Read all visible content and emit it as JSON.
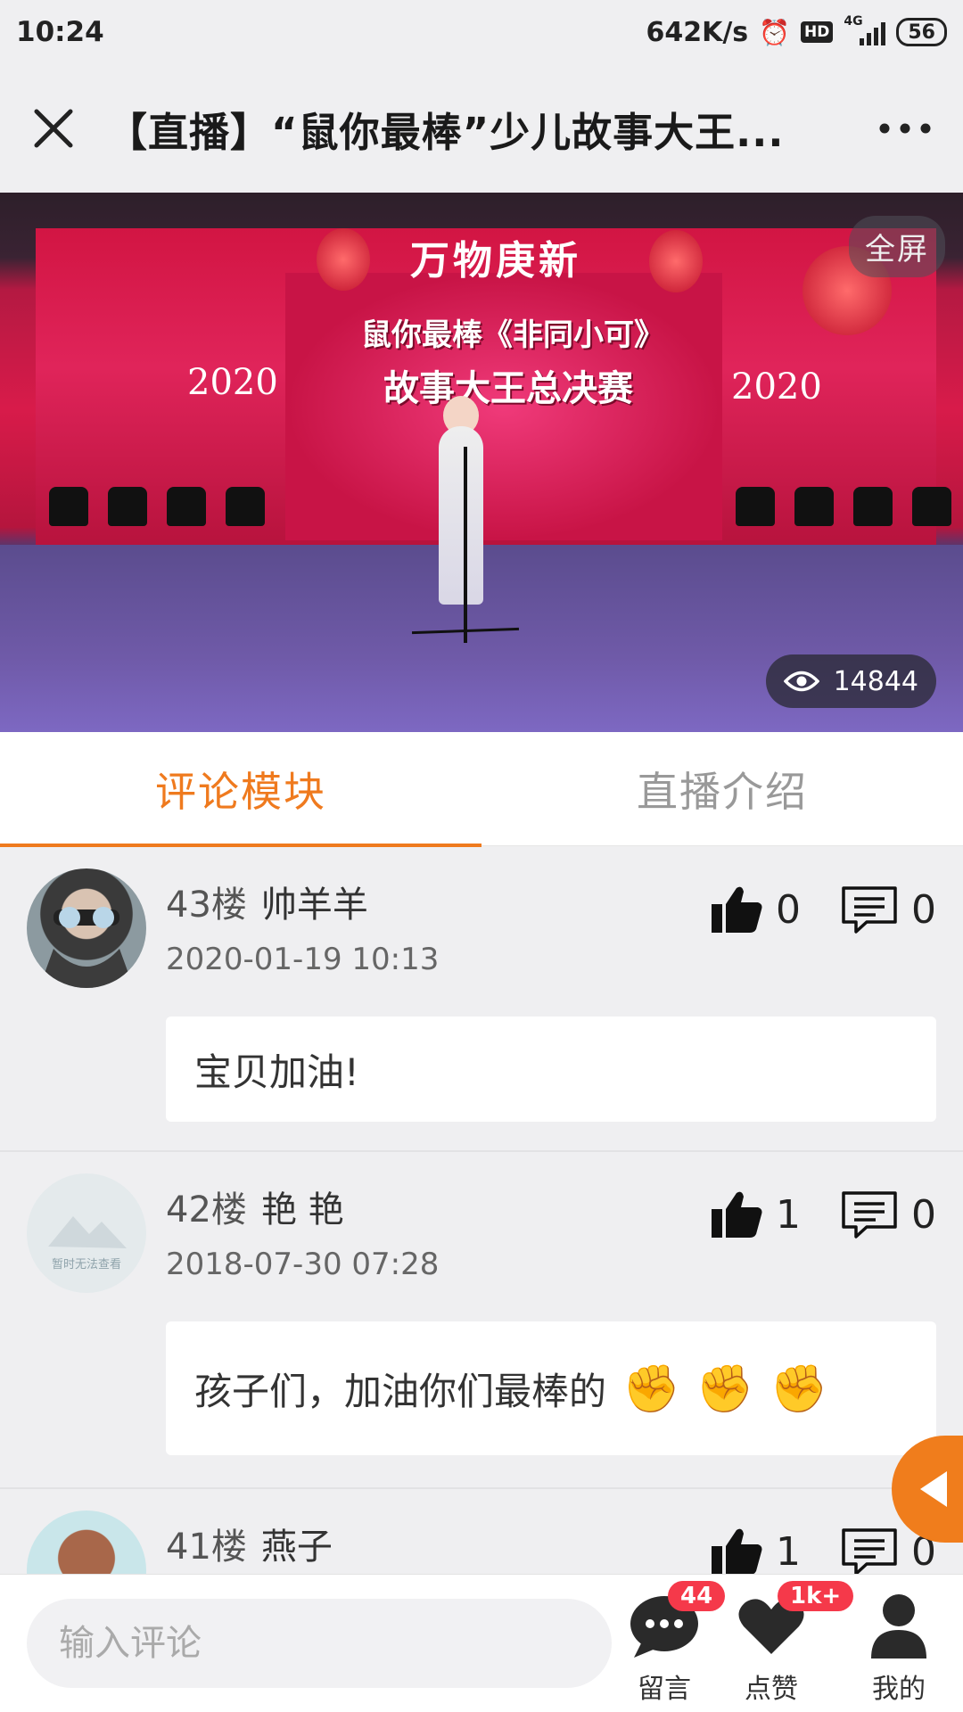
{
  "status_bar": {
    "time": "10:24",
    "speed": "642K/s",
    "hd": "HD",
    "network": "4G",
    "battery": "56"
  },
  "header": {
    "title": "【直播】“鼠你最棒”少儿故事大王...",
    "close_icon": "close-icon",
    "more_icon": "more-icon"
  },
  "video": {
    "fullscreen_label": "全屏",
    "view_count": "14844",
    "banner": "万物庚新",
    "event_title_line1": "鼠你最棒《非同小可》",
    "event_title_line2": "故事大王总决赛",
    "year_text": "2020"
  },
  "tabs": [
    {
      "label": "评论模块",
      "active": true
    },
    {
      "label": "直播介绍",
      "active": false
    }
  ],
  "comments": [
    {
      "floor": "43楼",
      "user": "帅羊羊",
      "date": "2020-01-19 10:13",
      "likes": "0",
      "replies": "0",
      "text": "宝贝加油!",
      "fists": 0
    },
    {
      "floor": "42楼",
      "user": "艳 艳",
      "date": "2018-07-30 07:28",
      "likes": "1",
      "replies": "0",
      "text": "孩子们，加油你们最棒的",
      "fists": 3,
      "avatar_placeholder": "暂时无法查看"
    },
    {
      "floor": "41楼",
      "user": "燕子",
      "date": "",
      "likes": "1",
      "replies": "0",
      "text": "",
      "fists": 0
    }
  ],
  "bottom_bar": {
    "input_placeholder": "输入评论",
    "nav": [
      {
        "label": "留言",
        "icon": "chat-bubble-icon",
        "badge": "44"
      },
      {
        "label": "点赞",
        "icon": "heart-icon",
        "badge": "1k+"
      },
      {
        "label": "我的",
        "icon": "user-icon",
        "badge": ""
      }
    ]
  },
  "colors": {
    "accent": "#ef7a1e",
    "badge": "#f5394a",
    "background": "#efeff1"
  }
}
